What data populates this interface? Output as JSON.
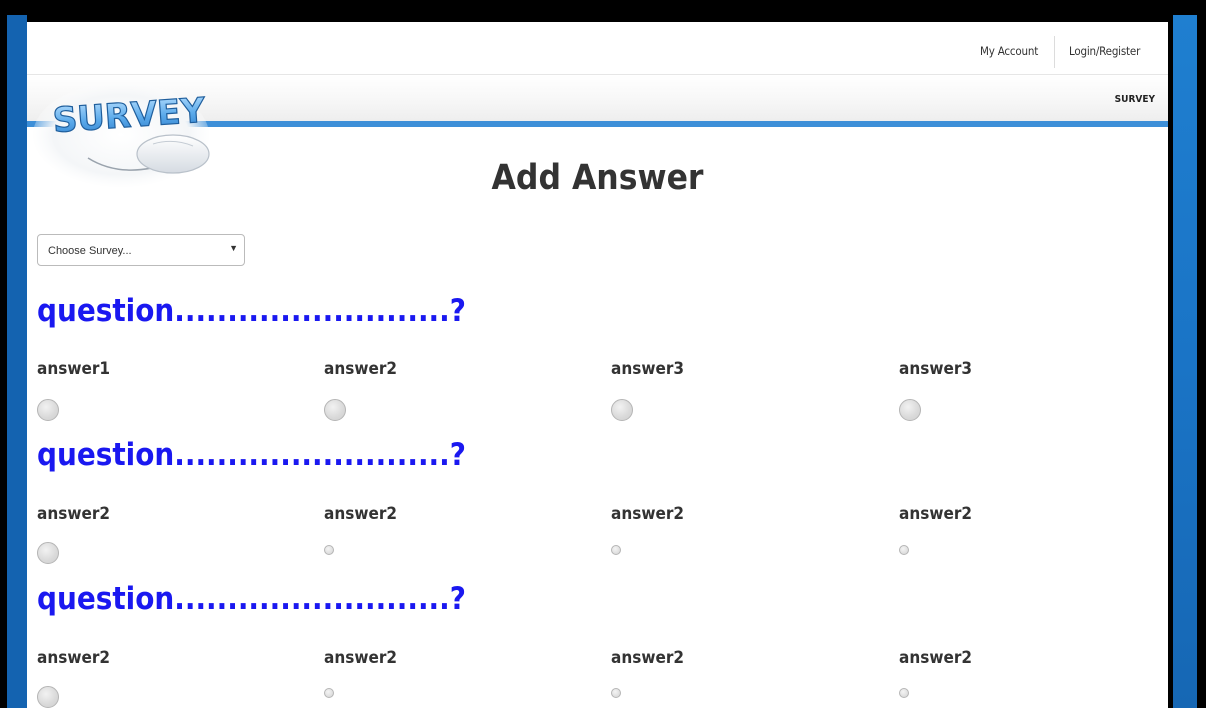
{
  "header": {
    "links": [
      "My Account",
      "Login/Register"
    ]
  },
  "nav": {
    "brand": "SURVEY"
  },
  "logo": {
    "text": "SURVEY"
  },
  "page": {
    "title": "Add Answer"
  },
  "survey_select": {
    "selected": "Choose Survey..."
  },
  "questions": [
    {
      "text": "question..........................?",
      "answers": [
        {
          "label": "answer1",
          "radio_style": "large"
        },
        {
          "label": "answer2",
          "radio_style": "large"
        },
        {
          "label": "answer3",
          "radio_style": "large"
        },
        {
          "label": "answer3",
          "radio_style": "large"
        }
      ]
    },
    {
      "text": "question..........................?",
      "answers": [
        {
          "label": "answer2",
          "radio_style": "large"
        },
        {
          "label": "answer2",
          "radio_style": "small"
        },
        {
          "label": "answer2",
          "radio_style": "small"
        },
        {
          "label": "answer2",
          "radio_style": "small"
        }
      ]
    },
    {
      "text": "question..........................?",
      "answers": [
        {
          "label": "answer2",
          "radio_style": "large"
        },
        {
          "label": "answer2",
          "radio_style": "small"
        },
        {
          "label": "answer2",
          "radio_style": "small"
        },
        {
          "label": "answer2",
          "radio_style": "small"
        }
      ]
    }
  ],
  "colors": {
    "question": "#1a18f0",
    "accent_line": "#3d8fd8",
    "frame_blue": "#1a74c6"
  }
}
